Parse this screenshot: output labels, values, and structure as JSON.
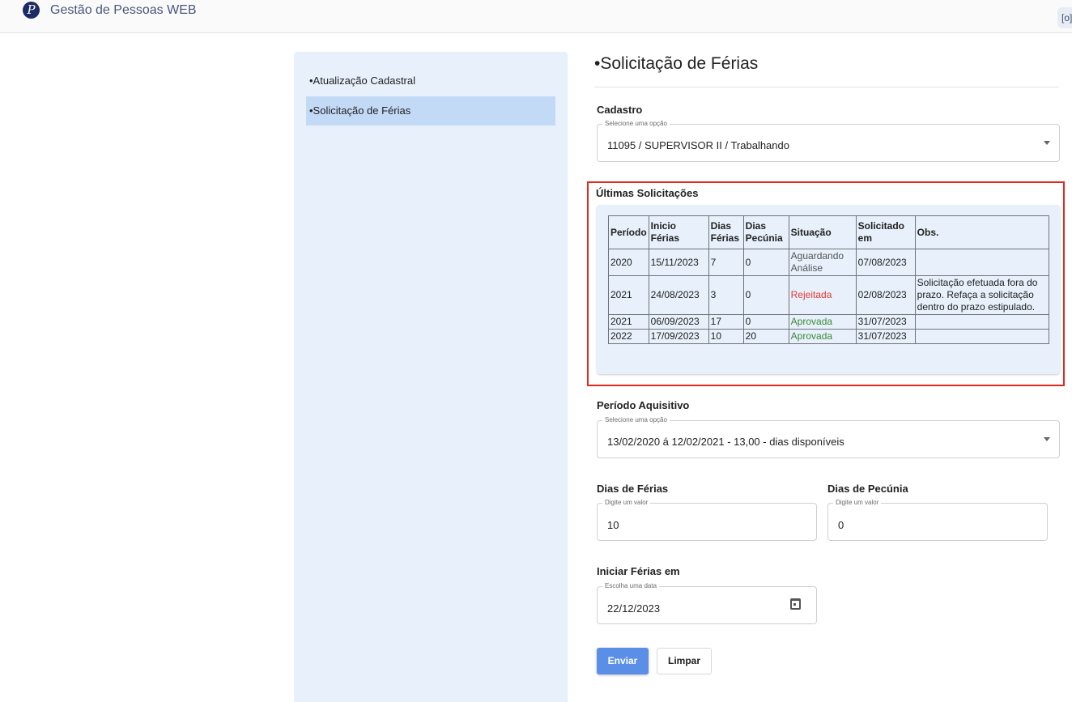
{
  "app": {
    "title": "Gestão de Pessoas WEB",
    "logo_letter": "P",
    "corner_icon": "screen-capture-icon",
    "corner_text": "[o]"
  },
  "sidebar": {
    "items": [
      {
        "label": "•Atualização Cadastral",
        "active": false
      },
      {
        "label": "•Solicitação de Férias",
        "active": true
      }
    ]
  },
  "main": {
    "title": "•Solicitação de Férias",
    "cadastro": {
      "label": "Cadastro",
      "legend": "Selecione uma opção",
      "value": "11095 / SUPERVISOR II / Trabalhando"
    },
    "ultimas": {
      "label": "Últimas Solicitações",
      "headers": [
        "Período",
        "Inicio Férias",
        "Dias Férias",
        "Dias Pecúnia",
        "Situação",
        "Solicitado em",
        "Obs."
      ],
      "rows": [
        {
          "periodo": "2020",
          "inicio": "15/11/2023",
          "dias_ferias": "7",
          "dias_pecunia": "0",
          "situacao": "Aguardando Análise",
          "solicitado": "07/08/2023",
          "obs": ""
        },
        {
          "periodo": "2021",
          "inicio": "24/08/2023",
          "dias_ferias": "3",
          "dias_pecunia": "0",
          "situacao": "Rejeitada",
          "solicitado": "02/08/2023",
          "obs": "Solicitação efetuada fora do prazo. Refaça a solicitação dentro do prazo estipulado."
        },
        {
          "periodo": "2021",
          "inicio": "06/09/2023",
          "dias_ferias": "17",
          "dias_pecunia": "0",
          "situacao": "Aprovada",
          "solicitado": "31/07/2023",
          "obs": ""
        },
        {
          "periodo": "2022",
          "inicio": "17/09/2023",
          "dias_ferias": "10",
          "dias_pecunia": "20",
          "situacao": "Aprovada",
          "solicitado": "31/07/2023",
          "obs": ""
        }
      ]
    },
    "periodo_aquisitivo": {
      "label": "Período Aquisitivo",
      "legend": "Selecione uma opção",
      "value": "13/02/2020 á 12/02/2021 - 13,00 - dias disponíveis"
    },
    "dias_ferias": {
      "label": "Dias de Férias",
      "legend": "Digite um valor",
      "value": "10"
    },
    "dias_pecunia": {
      "label": "Dias de Pecúnia",
      "legend": "Digite um valor",
      "value": "0"
    },
    "iniciar": {
      "label": "Iniciar Férias em",
      "legend": "Escolha uma data",
      "value": "22/12/2023"
    },
    "buttons": {
      "send": "Enviar",
      "clear": "Limpar"
    }
  },
  "colors": {
    "accent": "#5b8ee6",
    "highlight": "#e02a1e",
    "rejected": "#e53935",
    "approved": "#3c8a35"
  }
}
